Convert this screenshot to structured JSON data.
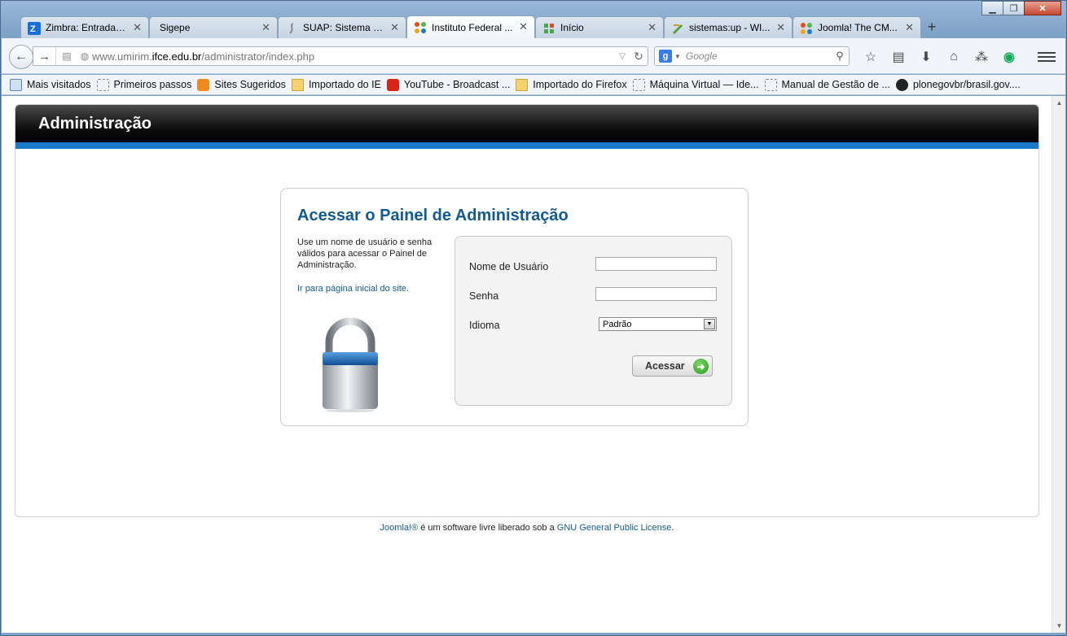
{
  "window": {
    "controls": {
      "minimize": "▁",
      "maximize": "❐",
      "close": "✕"
    }
  },
  "tabs": [
    {
      "label": "Zimbra: Entrada (...",
      "icon": "zimbra-icon",
      "active": false
    },
    {
      "label": "Sigepe",
      "icon": "",
      "active": false
    },
    {
      "label": "SUAP: Sistema U...",
      "icon": "suap-icon",
      "active": false
    },
    {
      "label": "Instituto Federal ...",
      "icon": "joomla-icon",
      "active": true
    },
    {
      "label": "Início",
      "icon": "grid-icon",
      "active": false
    },
    {
      "label": "sistemas:up - WI...",
      "icon": "wiki-icon",
      "active": false
    },
    {
      "label": "Joomla! The CM...",
      "icon": "joomla-icon",
      "active": false
    }
  ],
  "newtab_label": "+",
  "tab_close": "✕",
  "address": {
    "prefix": "www.umirim.",
    "domain": "ifce.edu.br",
    "path": "/administrator/index.php"
  },
  "search": {
    "engine": "g",
    "placeholder": "Google"
  },
  "bookmarks": [
    {
      "label": "Mais visitados",
      "icon": "blue"
    },
    {
      "label": "Primeiros passos",
      "icon": ""
    },
    {
      "label": "Sites Sugeridos",
      "icon": "bulb"
    },
    {
      "label": "Importado do IE",
      "icon": "folder"
    },
    {
      "label": "YouTube - Broadcast ...",
      "icon": "yt"
    },
    {
      "label": "Importado do Firefox",
      "icon": "folder"
    },
    {
      "label": "Máquina Virtual — Ide...",
      "icon": ""
    },
    {
      "label": "Manual de Gestão de ...",
      "icon": ""
    },
    {
      "label": "plonegovbr/brasil.gov....",
      "icon": "gh"
    }
  ],
  "page": {
    "header_title": "Administração",
    "login": {
      "title": "Acessar o Painel de Administração",
      "description": "Use um nome de usuário e senha válidos para acessar o Painel de Administração.",
      "home_link": "Ir para página inicial do site.",
      "username_label": "Nome de Usuário",
      "password_label": "Senha",
      "language_label": "Idioma",
      "language_value": "Padrão",
      "username_value": "",
      "password_value": "",
      "submit_label": "Acessar"
    },
    "footer": {
      "link1": "Joomla!®",
      "middle": " é um software livre liberado sob a ",
      "link2": "GNU General Public License",
      "end": "."
    }
  },
  "colors": {
    "accent": "#135b8e",
    "header_stripe": "#1a7ac8",
    "go_button": "#2a9a18"
  }
}
